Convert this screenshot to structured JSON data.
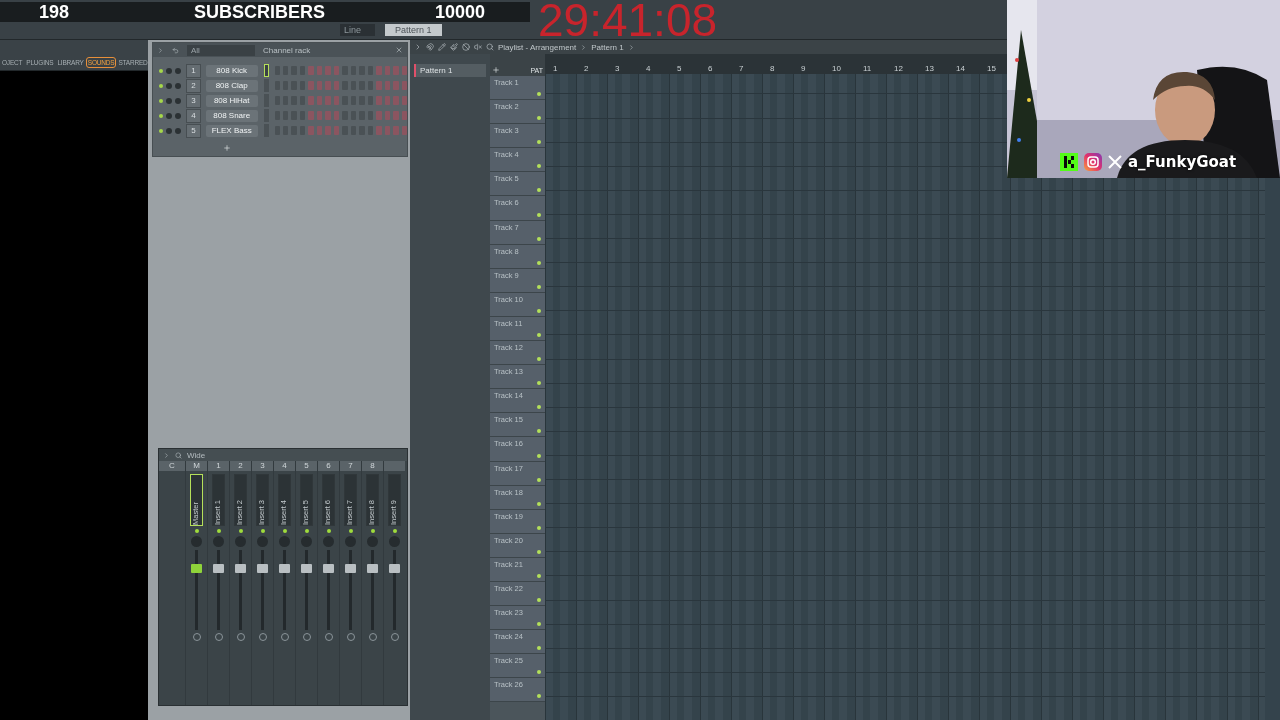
{
  "toolbar": {
    "snap": "Line",
    "pattern": "Pattern 1"
  },
  "overlay": {
    "count": "198",
    "label": "SUBSCRIBERS",
    "goal": "10000",
    "timer": "29:41:08"
  },
  "browser": {
    "tabs": [
      {
        "label": "OJECT",
        "selected": false
      },
      {
        "label": "PLUGINS",
        "selected": false
      },
      {
        "label": "LIBRARY",
        "selected": false
      },
      {
        "label": "SOUNDS",
        "selected": true
      },
      {
        "label": "STARRED",
        "selected": false
      }
    ]
  },
  "channel_rack": {
    "title": "Channel rack",
    "filter": "All",
    "channels": [
      {
        "number": "1",
        "name": "808 Kick",
        "selected": true
      },
      {
        "number": "2",
        "name": "808 Clap",
        "selected": false
      },
      {
        "number": "3",
        "name": "808 HiHat",
        "selected": false
      },
      {
        "number": "4",
        "name": "808 Snare",
        "selected": false
      },
      {
        "number": "5",
        "name": "FLEX Bass",
        "selected": false
      }
    ]
  },
  "mixer": {
    "title": "Wide",
    "current": "C",
    "tracks": [
      {
        "number": "M",
        "name": "Master",
        "selected": true,
        "level": 0.8
      },
      {
        "number": "1",
        "name": "Insert 1",
        "selected": false,
        "level": 0.8
      },
      {
        "number": "2",
        "name": "Insert 2",
        "selected": false,
        "level": 0.8
      },
      {
        "number": "3",
        "name": "Insert 3",
        "selected": false,
        "level": 0.8
      },
      {
        "number": "4",
        "name": "Insert 4",
        "selected": false,
        "level": 0.8
      },
      {
        "number": "5",
        "name": "Insert 5",
        "selected": false,
        "level": 0.8
      },
      {
        "number": "6",
        "name": "Insert 6",
        "selected": false,
        "level": 0.8
      },
      {
        "number": "7",
        "name": "Insert 7",
        "selected": false,
        "level": 0.8
      },
      {
        "number": "8",
        "name": "Insert 8",
        "selected": false,
        "level": 0.8
      },
      {
        "name": "Insert 9",
        "selected": false,
        "level": 0.8
      }
    ]
  },
  "playlist": {
    "title": "Playlist - Arrangement",
    "pattern": "Pattern 1",
    "pat_label": "PAT",
    "patterns": [
      {
        "name": "Pattern 1",
        "selected": true
      }
    ],
    "ruler": [
      "1",
      "2",
      "3",
      "4",
      "5",
      "6",
      "7",
      "8",
      "9",
      "10",
      "11",
      "12",
      "13",
      "14",
      "15"
    ],
    "tracks": [
      "Track 1",
      "Track 2",
      "Track 3",
      "Track 4",
      "Track 5",
      "Track 6",
      "Track 7",
      "Track 8",
      "Track 9",
      "Track 10",
      "Track 11",
      "Track 12",
      "Track 13",
      "Track 14",
      "Track 15",
      "Track 16",
      "Track 17",
      "Track 18",
      "Track 19",
      "Track 20",
      "Track 21",
      "Track 22",
      "Track 23",
      "Track 24",
      "Track 25",
      "Track 26"
    ]
  },
  "stream": {
    "handle": "a_FunkyGoat"
  }
}
